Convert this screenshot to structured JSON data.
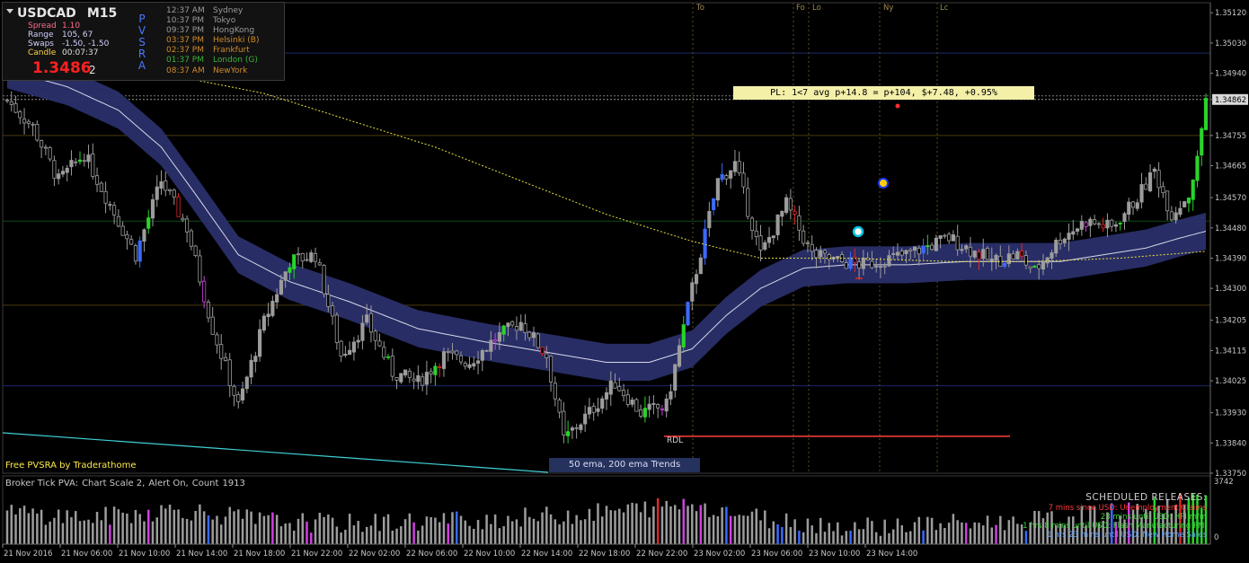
{
  "info": {
    "symbol": "USDCAD",
    "timeframe": "M15",
    "spread_label": "Spread",
    "spread_value": "1.10",
    "range_label": "Range",
    "range_value": "105, 67",
    "swaps_label": "Swaps",
    "swaps_value": "-1.50, -1.50",
    "candle_label": "Candle",
    "candle_value": "00:07:37",
    "price": "1.3486",
    "price_digit": "2",
    "pvsra_letters": [
      "P",
      "V",
      "S",
      "R",
      "A"
    ]
  },
  "sessions": [
    {
      "time": "12:37 AM",
      "name": "Sydney",
      "color": "#9a9a9a"
    },
    {
      "time": "10:37 PM",
      "name": "Tokyo",
      "color": "#9a9a9a"
    },
    {
      "time": "09:37 PM",
      "name": "HongKong",
      "color": "#9a9a9a"
    },
    {
      "time": "03:37 PM",
      "name": "Helsinki  (B)",
      "color": "#d08a2a"
    },
    {
      "time": "02:37 PM",
      "name": "Frankfurt",
      "color": "#d08a2a"
    },
    {
      "time": "01:37 PM",
      "name": "London  (G)",
      "color": "#3ab03a"
    },
    {
      "time": "08:37 AM",
      "name": "NewYork",
      "color": "#d08a2a"
    }
  ],
  "session_markers": [
    {
      "label": "To"
    },
    {
      "label": "Fo"
    },
    {
      "label": "Lo"
    },
    {
      "label": "Ny"
    },
    {
      "label": "Lc"
    }
  ],
  "pl_banner": "PL: 1<7 avg p+14.8 = p+104, $+7.48, +0.95%",
  "footer_left": "Free  PVSRA  by  Traderathome",
  "ema_badge": "50 ema, 200 ema Trends",
  "rdl_label": "RDL",
  "current_price_label": "1.34862",
  "volume_panel": {
    "header": [
      "Broker Tick PVA:",
      "Chart Scale  2,",
      "Alert On,",
      "Count",
      "1913"
    ],
    "max_label": "3742",
    "zero_label": "0"
  },
  "scheduled": {
    "title": "SCHEDULED RELEASES:",
    "rows": [
      {
        "text": "7 mins since USD: Unemployment Claims",
        "color": "#ff3b3b"
      },
      {
        "text": "23 mins until USD: HPI m/m",
        "color": "#3ed63e"
      },
      {
        "text": "1 hrs 8 mins until USD: Flash Manufacturing PMI",
        "color": "#3ed63e"
      },
      {
        "text": "1 hrs 23 mins until USD: New Home Sales",
        "color": "#5aa0ff"
      }
    ]
  },
  "colors": {
    "background": "#000000",
    "grid_level": "#4a3a10",
    "bull_normal": "#9c9c9c",
    "bear_normal": "#9c9c9c",
    "climax_bull": "#2ad42a",
    "climax_bear": "#e02828",
    "rising_bull": "#3a6aff",
    "rising_bear": "#d040e0",
    "ema_band": "#2a2f6a",
    "ema200": "#e8e040",
    "rdl": "#ff4040",
    "trend_cyan": "#40d0d8"
  },
  "chart_data": {
    "type": "candlestick",
    "symbol": "USDCAD",
    "timeframe": "M15",
    "ylim": [
      1.3375,
      1.3515
    ],
    "y_ticks": [
      "1.35120",
      "1.35030",
      "1.34940",
      "1.34862",
      "1.34755",
      "1.34665",
      "1.34570",
      "1.34480",
      "1.34390",
      "1.34300",
      "1.34205",
      "1.34115",
      "1.34025",
      "1.33930",
      "1.33840",
      "1.33750"
    ],
    "x_ticks": [
      "21 Nov 2016",
      "21 Nov 06:00",
      "21 Nov 10:00",
      "21 Nov 14:00",
      "21 Nov 18:00",
      "21 Nov 22:00",
      "22 Nov 02:00",
      "22 Nov 06:00",
      "22 Nov 10:00",
      "22 Nov 14:00",
      "22 Nov 18:00",
      "22 Nov 22:00",
      "23 Nov 02:00",
      "23 Nov 06:00",
      "23 Nov 10:00",
      "23 Nov 14:00"
    ],
    "current_price": 1.34862,
    "rdl_level": 1.3386,
    "close_keypoints": [
      [
        0,
        1.3486
      ],
      [
        6,
        1.3478
      ],
      [
        12,
        1.3462
      ],
      [
        18,
        1.347
      ],
      [
        24,
        1.3455
      ],
      [
        30,
        1.344
      ],
      [
        36,
        1.3462
      ],
      [
        42,
        1.3448
      ],
      [
        48,
        1.3418
      ],
      [
        54,
        1.3395
      ],
      [
        60,
        1.342
      ],
      [
        66,
        1.3438
      ],
      [
        72,
        1.344
      ],
      [
        78,
        1.341
      ],
      [
        84,
        1.342
      ],
      [
        90,
        1.3405
      ],
      [
        96,
        1.3402
      ],
      [
        102,
        1.341
      ],
      [
        108,
        1.3408
      ],
      [
        114,
        1.3415
      ],
      [
        120,
        1.342
      ],
      [
        126,
        1.341
      ],
      [
        130,
        1.3385
      ],
      [
        136,
        1.3393
      ],
      [
        142,
        1.3402
      ],
      [
        148,
        1.3393
      ],
      [
        154,
        1.3395
      ],
      [
        160,
        1.343
      ],
      [
        166,
        1.3462
      ],
      [
        170,
        1.3467
      ],
      [
        176,
        1.344
      ],
      [
        182,
        1.3455
      ],
      [
        188,
        1.344
      ],
      [
        194,
        1.3438
      ],
      [
        200,
        1.3437
      ],
      [
        210,
        1.344
      ],
      [
        220,
        1.3445
      ],
      [
        230,
        1.3438
      ],
      [
        236,
        1.344
      ],
      [
        240,
        1.3435
      ],
      [
        246,
        1.3445
      ],
      [
        252,
        1.345
      ],
      [
        258,
        1.3448
      ],
      [
        264,
        1.3457
      ],
      [
        268,
        1.3465
      ],
      [
        272,
        1.3452
      ],
      [
        276,
        1.3458
      ],
      [
        278,
        1.3468
      ],
      [
        280,
        1.3487
      ]
    ],
    "ema50_keypoints": [
      [
        0,
        1.3495
      ],
      [
        14,
        1.349
      ],
      [
        26,
        1.3483
      ],
      [
        36,
        1.3472
      ],
      [
        44,
        1.3458
      ],
      [
        54,
        1.344
      ],
      [
        66,
        1.3432
      ],
      [
        80,
        1.3426
      ],
      [
        96,
        1.3418
      ],
      [
        112,
        1.3414
      ],
      [
        126,
        1.3411
      ],
      [
        140,
        1.3408
      ],
      [
        150,
        1.3408
      ],
      [
        160,
        1.3412
      ],
      [
        168,
        1.3422
      ],
      [
        176,
        1.343
      ],
      [
        186,
        1.3436
      ],
      [
        196,
        1.3437
      ],
      [
        210,
        1.3437
      ],
      [
        224,
        1.3438
      ],
      [
        236,
        1.3438
      ],
      [
        246,
        1.3438
      ],
      [
        256,
        1.344
      ],
      [
        266,
        1.3442
      ],
      [
        274,
        1.3445
      ],
      [
        280,
        1.3447
      ]
    ],
    "ema200_keypoints": [
      [
        0,
        1.3498
      ],
      [
        20,
        1.3496
      ],
      [
        40,
        1.3493
      ],
      [
        60,
        1.3488
      ],
      [
        80,
        1.348
      ],
      [
        100,
        1.3472
      ],
      [
        120,
        1.3462
      ],
      [
        140,
        1.3452
      ],
      [
        160,
        1.3444
      ],
      [
        176,
        1.3439
      ],
      [
        196,
        1.3439
      ],
      [
        220,
        1.3438
      ],
      [
        240,
        1.3438
      ],
      [
        260,
        1.3439
      ],
      [
        280,
        1.3441
      ]
    ],
    "volume_keypoints": [
      [
        0,
        0.55
      ],
      [
        20,
        0.45
      ],
      [
        40,
        0.6
      ],
      [
        60,
        0.4
      ],
      [
        80,
        0.35
      ],
      [
        100,
        0.4
      ],
      [
        120,
        0.45
      ],
      [
        140,
        0.55
      ],
      [
        160,
        0.7
      ],
      [
        176,
        0.45
      ],
      [
        196,
        0.3
      ],
      [
        220,
        0.35
      ],
      [
        240,
        0.4
      ],
      [
        260,
        0.55
      ],
      [
        270,
        0.65
      ],
      [
        280,
        0.8
      ]
    ],
    "bar_count": 281
  }
}
